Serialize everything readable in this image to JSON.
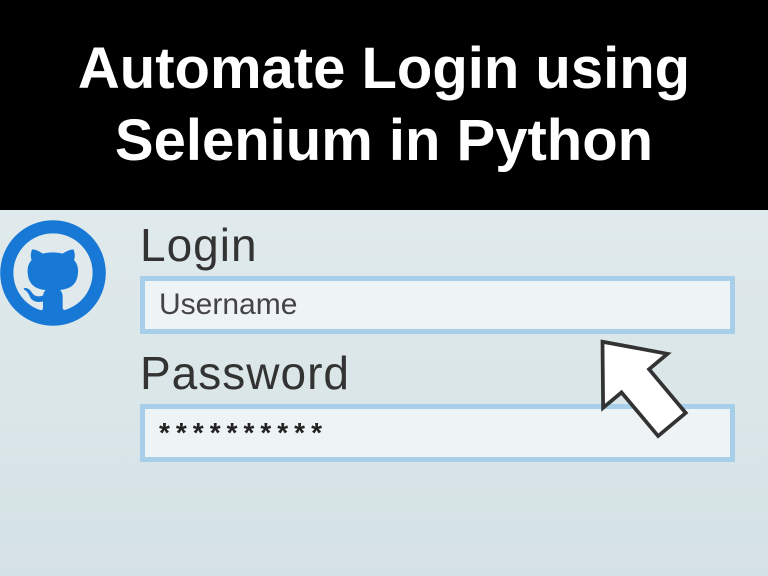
{
  "header": {
    "title": "Automate Login using Selenium in Python"
  },
  "form": {
    "login_label": "Login",
    "username_placeholder": "Username",
    "password_label": "Password",
    "password_value": "**********"
  }
}
